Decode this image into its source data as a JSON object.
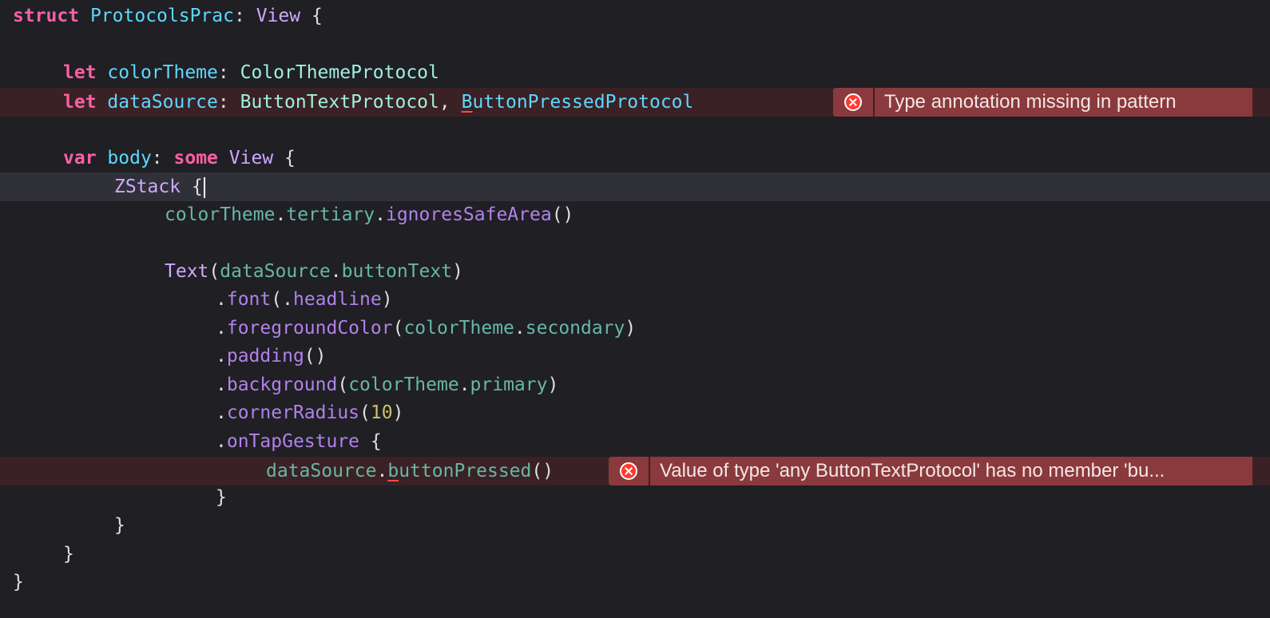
{
  "editor": {
    "line1": {
      "kw": "struct",
      "name": "ProtocolsPrac",
      "colon": ":",
      "type": "View",
      "brace": "{"
    },
    "line3": {
      "kw": "let",
      "name": "colorTheme",
      "colon": ":",
      "type": "ColorThemeProtocol"
    },
    "line4": {
      "kw": "let",
      "name": "dataSource",
      "colon": ":",
      "type1": "ButtonTextProtocol",
      "comma": ",",
      "type2_first": "B",
      "type2_rest": "uttonPressedProtocol"
    },
    "line6": {
      "kw": "var",
      "name": "body",
      "colon": ":",
      "kw2": "some",
      "type": "View",
      "brace": "{"
    },
    "line7": {
      "type": "ZStack",
      "brace": "{"
    },
    "line8": {
      "obj": "colorTheme",
      "dot1": ".",
      "member": "tertiary",
      "dot2": ".",
      "method": "ignoresSafeArea",
      "parens": "()"
    },
    "line10": {
      "type": "Text",
      "open": "(",
      "obj": "dataSource",
      "dot": ".",
      "member": "buttonText",
      "close": ")"
    },
    "line11": {
      "dot": ".",
      "method": "font",
      "open": "(",
      "dot2": ".",
      "arg": "headline",
      "close": ")"
    },
    "line12": {
      "dot": ".",
      "method": "foregroundColor",
      "open": "(",
      "obj": "colorTheme",
      "dot2": ".",
      "member": "secondary",
      "close": ")"
    },
    "line13": {
      "dot": ".",
      "method": "padding",
      "parens": "()"
    },
    "line14": {
      "dot": ".",
      "method": "background",
      "open": "(",
      "obj": "colorTheme",
      "dot2": ".",
      "member": "primary",
      "close": ")"
    },
    "line15": {
      "dot": ".",
      "method": "cornerRadius",
      "open": "(",
      "num": "10",
      "close": ")"
    },
    "line16": {
      "dot": ".",
      "method": "onTapGesture",
      "brace": "{"
    },
    "line17": {
      "obj": "dataSource",
      "dot": ".",
      "method_first": "b",
      "method_rest": "uttonPressed",
      "parens": "()"
    },
    "line18": {
      "brace": "}"
    },
    "line19": {
      "brace": "}"
    },
    "line20": {
      "brace": "}"
    },
    "line21": {
      "brace": "}"
    }
  },
  "errors": [
    {
      "message": "Type annotation missing in pattern",
      "icon": "error-x-circle-icon"
    },
    {
      "message": "Value of type 'any ButtonTextProtocol' has no member 'bu...",
      "icon": "error-x-circle-icon"
    }
  ],
  "colors": {
    "background": "#1f1f24",
    "keyword": "#fc5fa3",
    "error_banner": "#8a3a3c",
    "error_icon": "#ff3b30"
  }
}
